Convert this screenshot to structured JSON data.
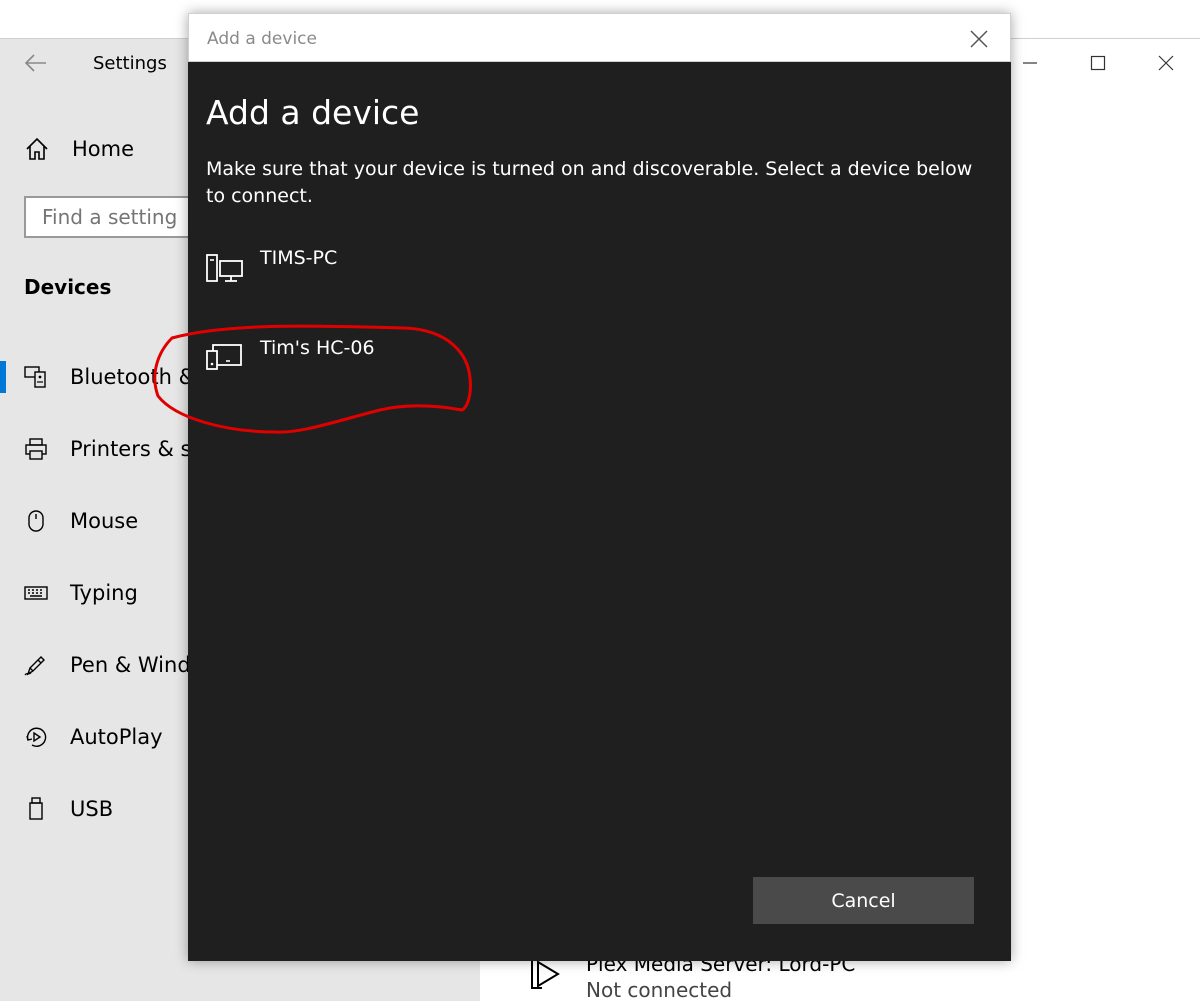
{
  "settings_window": {
    "title": "Settings",
    "home_label": "Home",
    "search_placeholder": "Find a setting",
    "section_title": "Devices",
    "nav_items": [
      {
        "label": "Bluetooth & other devices",
        "icon": "bluetooth-devices-icon",
        "selected": true
      },
      {
        "label": "Printers & scanners",
        "icon": "printer-icon",
        "selected": false
      },
      {
        "label": "Mouse",
        "icon": "mouse-icon",
        "selected": false
      },
      {
        "label": "Typing",
        "icon": "keyboard-icon",
        "selected": false
      },
      {
        "label": "Pen & Windows Ink",
        "icon": "pen-icon",
        "selected": false
      },
      {
        "label": "AutoPlay",
        "icon": "autoplay-icon",
        "selected": false
      },
      {
        "label": "USB",
        "icon": "usb-icon",
        "selected": false
      }
    ],
    "peek_item": {
      "name": "Plex Media Server: Lord-PC",
      "status": "Not connected"
    }
  },
  "dialog": {
    "titlebar": "Add a device",
    "heading": "Add a device",
    "description": "Make sure that your device is turned on and discoverable. Select a device below to connect.",
    "devices": [
      {
        "name": "TIMS-PC",
        "icon": "computer-icon"
      },
      {
        "name": "Tim's HC-06",
        "icon": "device-icon"
      }
    ],
    "cancel_label": "Cancel"
  },
  "colors": {
    "dialog_bg": "#1f1f1f",
    "sidebar_bg": "#e6e6e6",
    "accent": "#0078d7",
    "annotation": "#e00000"
  }
}
